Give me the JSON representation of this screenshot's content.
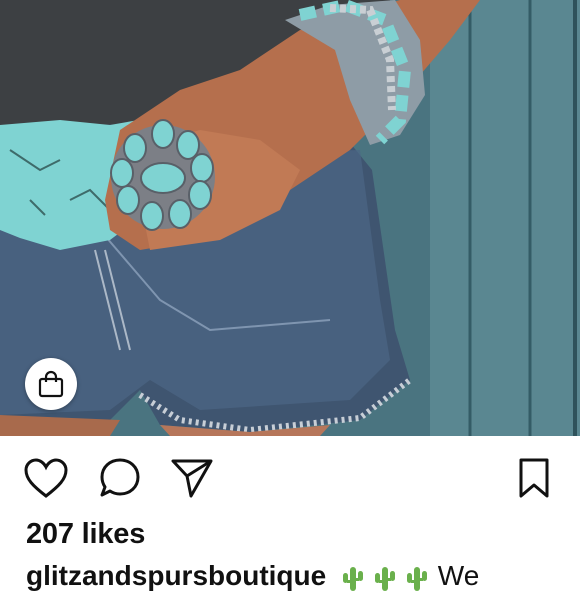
{
  "post": {
    "likes_text": "207 likes",
    "username": "glitzandspursboutique",
    "caption_text": "We",
    "caption_emoji": [
      "cactus-emoji",
      "cactus-emoji",
      "cactus-emoji"
    ]
  },
  "actions": {
    "icons": [
      "heart-icon",
      "comment-icon",
      "share-icon",
      "bookmark-icon"
    ]
  },
  "photo": {
    "subject": "turquoise jewelry photo",
    "accent_turquoise": "#7fd3d2",
    "denim": "#40566f",
    "wall": "#4f7b86"
  },
  "shop_button": {
    "icon": "shopping-bag-icon"
  }
}
